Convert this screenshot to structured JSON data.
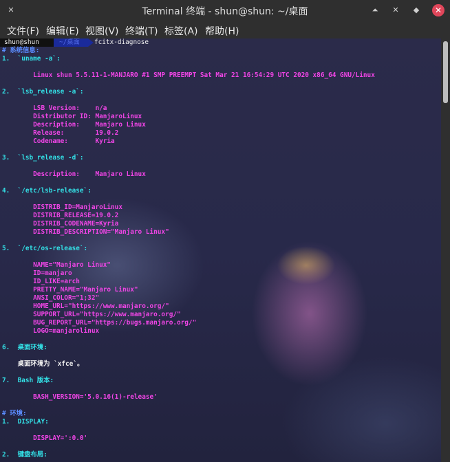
{
  "window": {
    "title": "Terminal 终端 - shun@shun: ~/桌面",
    "buttons": {
      "minimize": "⏶",
      "maximize": "✕",
      "restore": "◆",
      "close": "✕"
    }
  },
  "menu": [
    "文件(F)",
    "编辑(E)",
    "视图(V)",
    "终端(T)",
    "标签(A)",
    "帮助(H)"
  ],
  "prompt": {
    "user": "shun@shun",
    "dir": "~/桌面",
    "command": "fcitx-diagnose"
  },
  "lines": [
    {
      "text": "# 系统信息:",
      "color": "blue"
    },
    {
      "text": "1.  `uname -a`:",
      "color": "cyan"
    },
    {
      "text": "",
      "color": "mag"
    },
    {
      "text": "        Linux shun 5.5.11-1-MANJARO #1 SMP PREEMPT Sat Mar 21 16:54:29 UTC 2020 x86_64 GNU/Linux",
      "color": "mag"
    },
    {
      "text": "",
      "color": "mag"
    },
    {
      "text": "2.  `lsb_release -a`:",
      "color": "cyan"
    },
    {
      "text": "",
      "color": "mag"
    },
    {
      "text": "        LSB Version:    n/a",
      "color": "mag"
    },
    {
      "text": "        Distributor ID: ManjaroLinux",
      "color": "mag"
    },
    {
      "text": "        Description:    Manjaro Linux",
      "color": "mag"
    },
    {
      "text": "        Release:        19.0.2",
      "color": "mag"
    },
    {
      "text": "        Codename:       Kyria",
      "color": "mag"
    },
    {
      "text": "",
      "color": "mag"
    },
    {
      "text": "3.  `lsb_release -d`:",
      "color": "cyan"
    },
    {
      "text": "",
      "color": "mag"
    },
    {
      "text": "        Description:    Manjaro Linux",
      "color": "mag"
    },
    {
      "text": "",
      "color": "mag"
    },
    {
      "text": "4.  `/etc/lsb-release`:",
      "color": "cyan"
    },
    {
      "text": "",
      "color": "mag"
    },
    {
      "text": "        DISTRIB_ID=ManjaroLinux",
      "color": "mag"
    },
    {
      "text": "        DISTRIB_RELEASE=19.0.2",
      "color": "mag"
    },
    {
      "text": "        DISTRIB_CODENAME=Kyria",
      "color": "mag"
    },
    {
      "text": "        DISTRIB_DESCRIPTION=\"Manjaro Linux\"",
      "color": "mag"
    },
    {
      "text": "",
      "color": "mag"
    },
    {
      "text": "5.  `/etc/os-release`:",
      "color": "cyan"
    },
    {
      "text": "",
      "color": "mag"
    },
    {
      "text": "        NAME=\"Manjaro Linux\"",
      "color": "mag"
    },
    {
      "text": "        ID=manjaro",
      "color": "mag"
    },
    {
      "text": "        ID_LIKE=arch",
      "color": "mag"
    },
    {
      "text": "        PRETTY_NAME=\"Manjaro Linux\"",
      "color": "mag"
    },
    {
      "text": "        ANSI_COLOR=\"1;32\"",
      "color": "mag"
    },
    {
      "text": "        HOME_URL=\"https://www.manjaro.org/\"",
      "color": "mag"
    },
    {
      "text": "        SUPPORT_URL=\"https://www.manjaro.org/\"",
      "color": "mag"
    },
    {
      "text": "        BUG_REPORT_URL=\"https://bugs.manjaro.org/\"",
      "color": "mag"
    },
    {
      "text": "        LOGO=manjarolinux",
      "color": "mag"
    },
    {
      "text": "",
      "color": "mag"
    },
    {
      "text": "6.  桌面环境:",
      "color": "cyan"
    },
    {
      "text": "",
      "color": "mag"
    },
    {
      "text": "    桌面环境为 `xfce`。",
      "color": "white"
    },
    {
      "text": "",
      "color": "mag"
    },
    {
      "text": "7.  Bash 版本:",
      "color": "cyan"
    },
    {
      "text": "",
      "color": "mag"
    },
    {
      "text": "        BASH_VERSION='5.0.16(1)-release'",
      "color": "mag"
    },
    {
      "text": "",
      "color": "mag"
    },
    {
      "text": "# 环境:",
      "color": "blue"
    },
    {
      "text": "1.  DISPLAY:",
      "color": "cyan"
    },
    {
      "text": "",
      "color": "mag"
    },
    {
      "text": "        DISPLAY=':0.0'",
      "color": "mag"
    },
    {
      "text": "",
      "color": "mag"
    },
    {
      "text": "2.  键盘布局:",
      "color": "cyan"
    }
  ]
}
